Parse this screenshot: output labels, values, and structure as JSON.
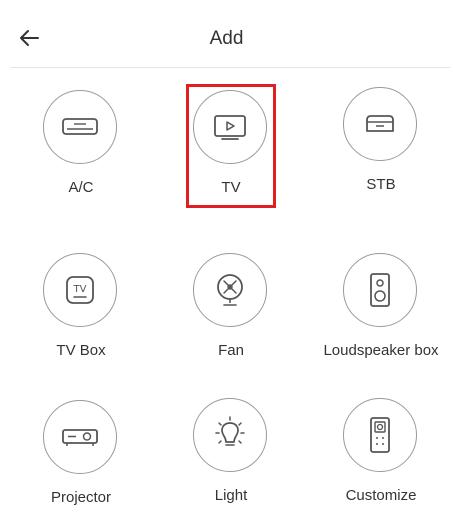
{
  "header": {
    "title": "Add",
    "back_icon": "arrow-left-icon"
  },
  "devices": [
    {
      "label": "A/C",
      "icon": "air-conditioner-icon"
    },
    {
      "label": "TV",
      "icon": "tv-icon",
      "selected": true
    },
    {
      "label": "STB",
      "icon": "set-top-box-icon"
    },
    {
      "label": "TV Box",
      "icon": "tv-box-icon"
    },
    {
      "label": "Fan",
      "icon": "fan-icon"
    },
    {
      "label": "Loudspeaker box",
      "icon": "speaker-icon"
    },
    {
      "label": "Projector",
      "icon": "projector-icon"
    },
    {
      "label": "Light",
      "icon": "light-bulb-icon"
    },
    {
      "label": "Customize",
      "icon": "remote-icon"
    }
  ],
  "colors": {
    "highlight": "#e02020",
    "icon_stroke": "#555555",
    "circle_border": "#9a9a9a"
  }
}
